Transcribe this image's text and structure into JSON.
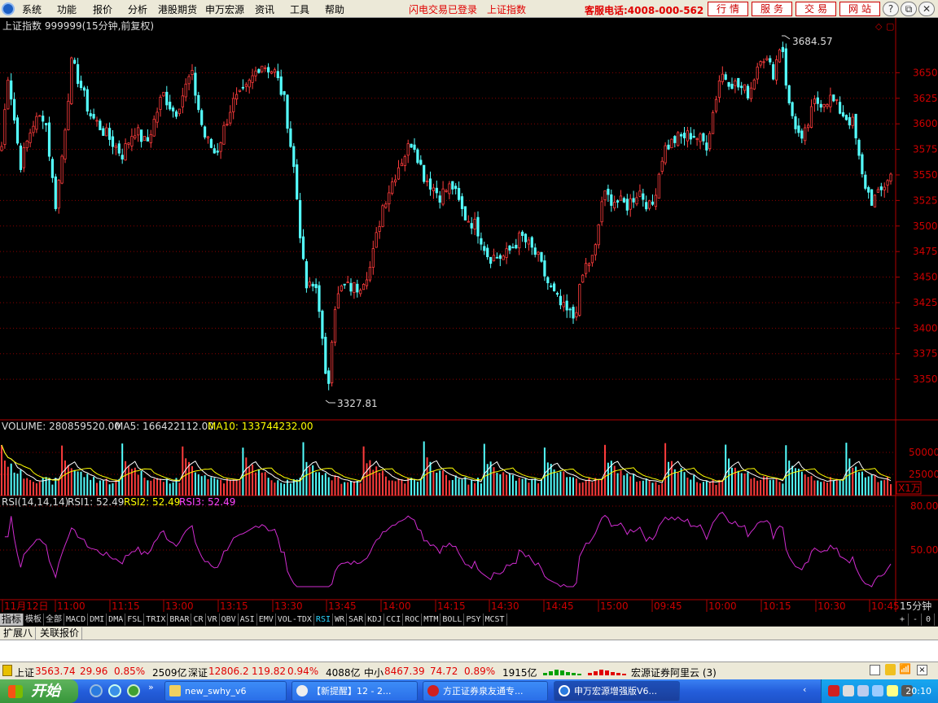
{
  "menu": {
    "items": [
      "系统",
      "功能",
      "报价",
      "分析",
      "港股期货",
      "申万宏源",
      "资讯",
      "工具",
      "帮助"
    ],
    "links": [
      "闪电交易已登录",
      "上证指数"
    ],
    "hotline": "客服电话:4008-000-562",
    "buttons": [
      "行情",
      "服务",
      "交易",
      "网站"
    ]
  },
  "chart": {
    "title": "上证指数 999999(15分钟,前复权)",
    "high_label": "3684.57",
    "low_label": "3327.81",
    "price_ticks": [
      "3650",
      "3625",
      "3600",
      "3575",
      "3550",
      "3525",
      "3500",
      "3475",
      "3450",
      "3425",
      "3400",
      "3375",
      "3350"
    ],
    "volume_header": {
      "label": "VOLUME: 280859520.00",
      "ma5": "MA5: 166422112.00",
      "ma10": "MA10: 133744232.00"
    },
    "volume_ticks": [
      "50000",
      "25000"
    ],
    "volume_unit": "X1万",
    "rsi_header": {
      "label": "RSI(14,14,14)",
      "rsi1": "RSI1: 52.49",
      "rsi2": "RSI2: 52.49",
      "rsi3": "RSI3: 52.49"
    },
    "rsi_ticks": [
      "80.00",
      "50.00"
    ],
    "time_ticks": [
      "11月12日",
      "11:00",
      "11:15",
      "13:00",
      "13:15",
      "13:30",
      "13:45",
      "14:00",
      "14:15",
      "14:30",
      "14:45",
      "15:00",
      "09:45",
      "10:00",
      "10:15",
      "10:30",
      "10:45"
    ],
    "period": "15分钟",
    "colors": {
      "up": "#ff3c3c",
      "down": "#54ffff",
      "ma5": "#ffffff",
      "ma10": "#ffff00",
      "rsi": "#d02cd0",
      "grid": "#8a0000",
      "axis": "#b00000"
    }
  },
  "indicator_tabs": [
    "指标",
    "模板",
    "全部",
    "MACD",
    "DMI",
    "DMA",
    "FSL",
    "TRIX",
    "BRAR",
    "CR",
    "VR",
    "OBV",
    "ASI",
    "EMV",
    "VOL-TDX",
    "RSI",
    "WR",
    "SAR",
    "KDJ",
    "CCI",
    "ROC",
    "MTM",
    "BOLL",
    "PSY",
    "MCST"
  ],
  "active_indicator": "RSI",
  "right_controls": [
    "+",
    "-",
    "0"
  ],
  "ext_tabs": [
    "扩展八",
    "关联报价"
  ],
  "status": {
    "sh_name": "上证",
    "sh_value": "3563.74",
    "sh_change": "29.96",
    "sh_pct": "0.85%",
    "sh_amount": "2509亿",
    "sz_name": "深证",
    "sz_value": "12806.2",
    "sz_change": "119.82",
    "sz_pct": "0.94%",
    "sz_amount": "4088亿",
    "zx_name": "中小",
    "zx_value": "8467.39",
    "zx_change": "74.72",
    "zx_pct": "0.89%",
    "zx_amount": "1915亿",
    "broker": "宏源证券阿里云 (3)"
  },
  "taskbar": {
    "start": "开始",
    "tasks": [
      "new_swhy_v6",
      "【新提醒】12 - 2...",
      "方正证券泉友通专...",
      "申万宏源增强版V6..."
    ],
    "clock": "20:10"
  }
}
